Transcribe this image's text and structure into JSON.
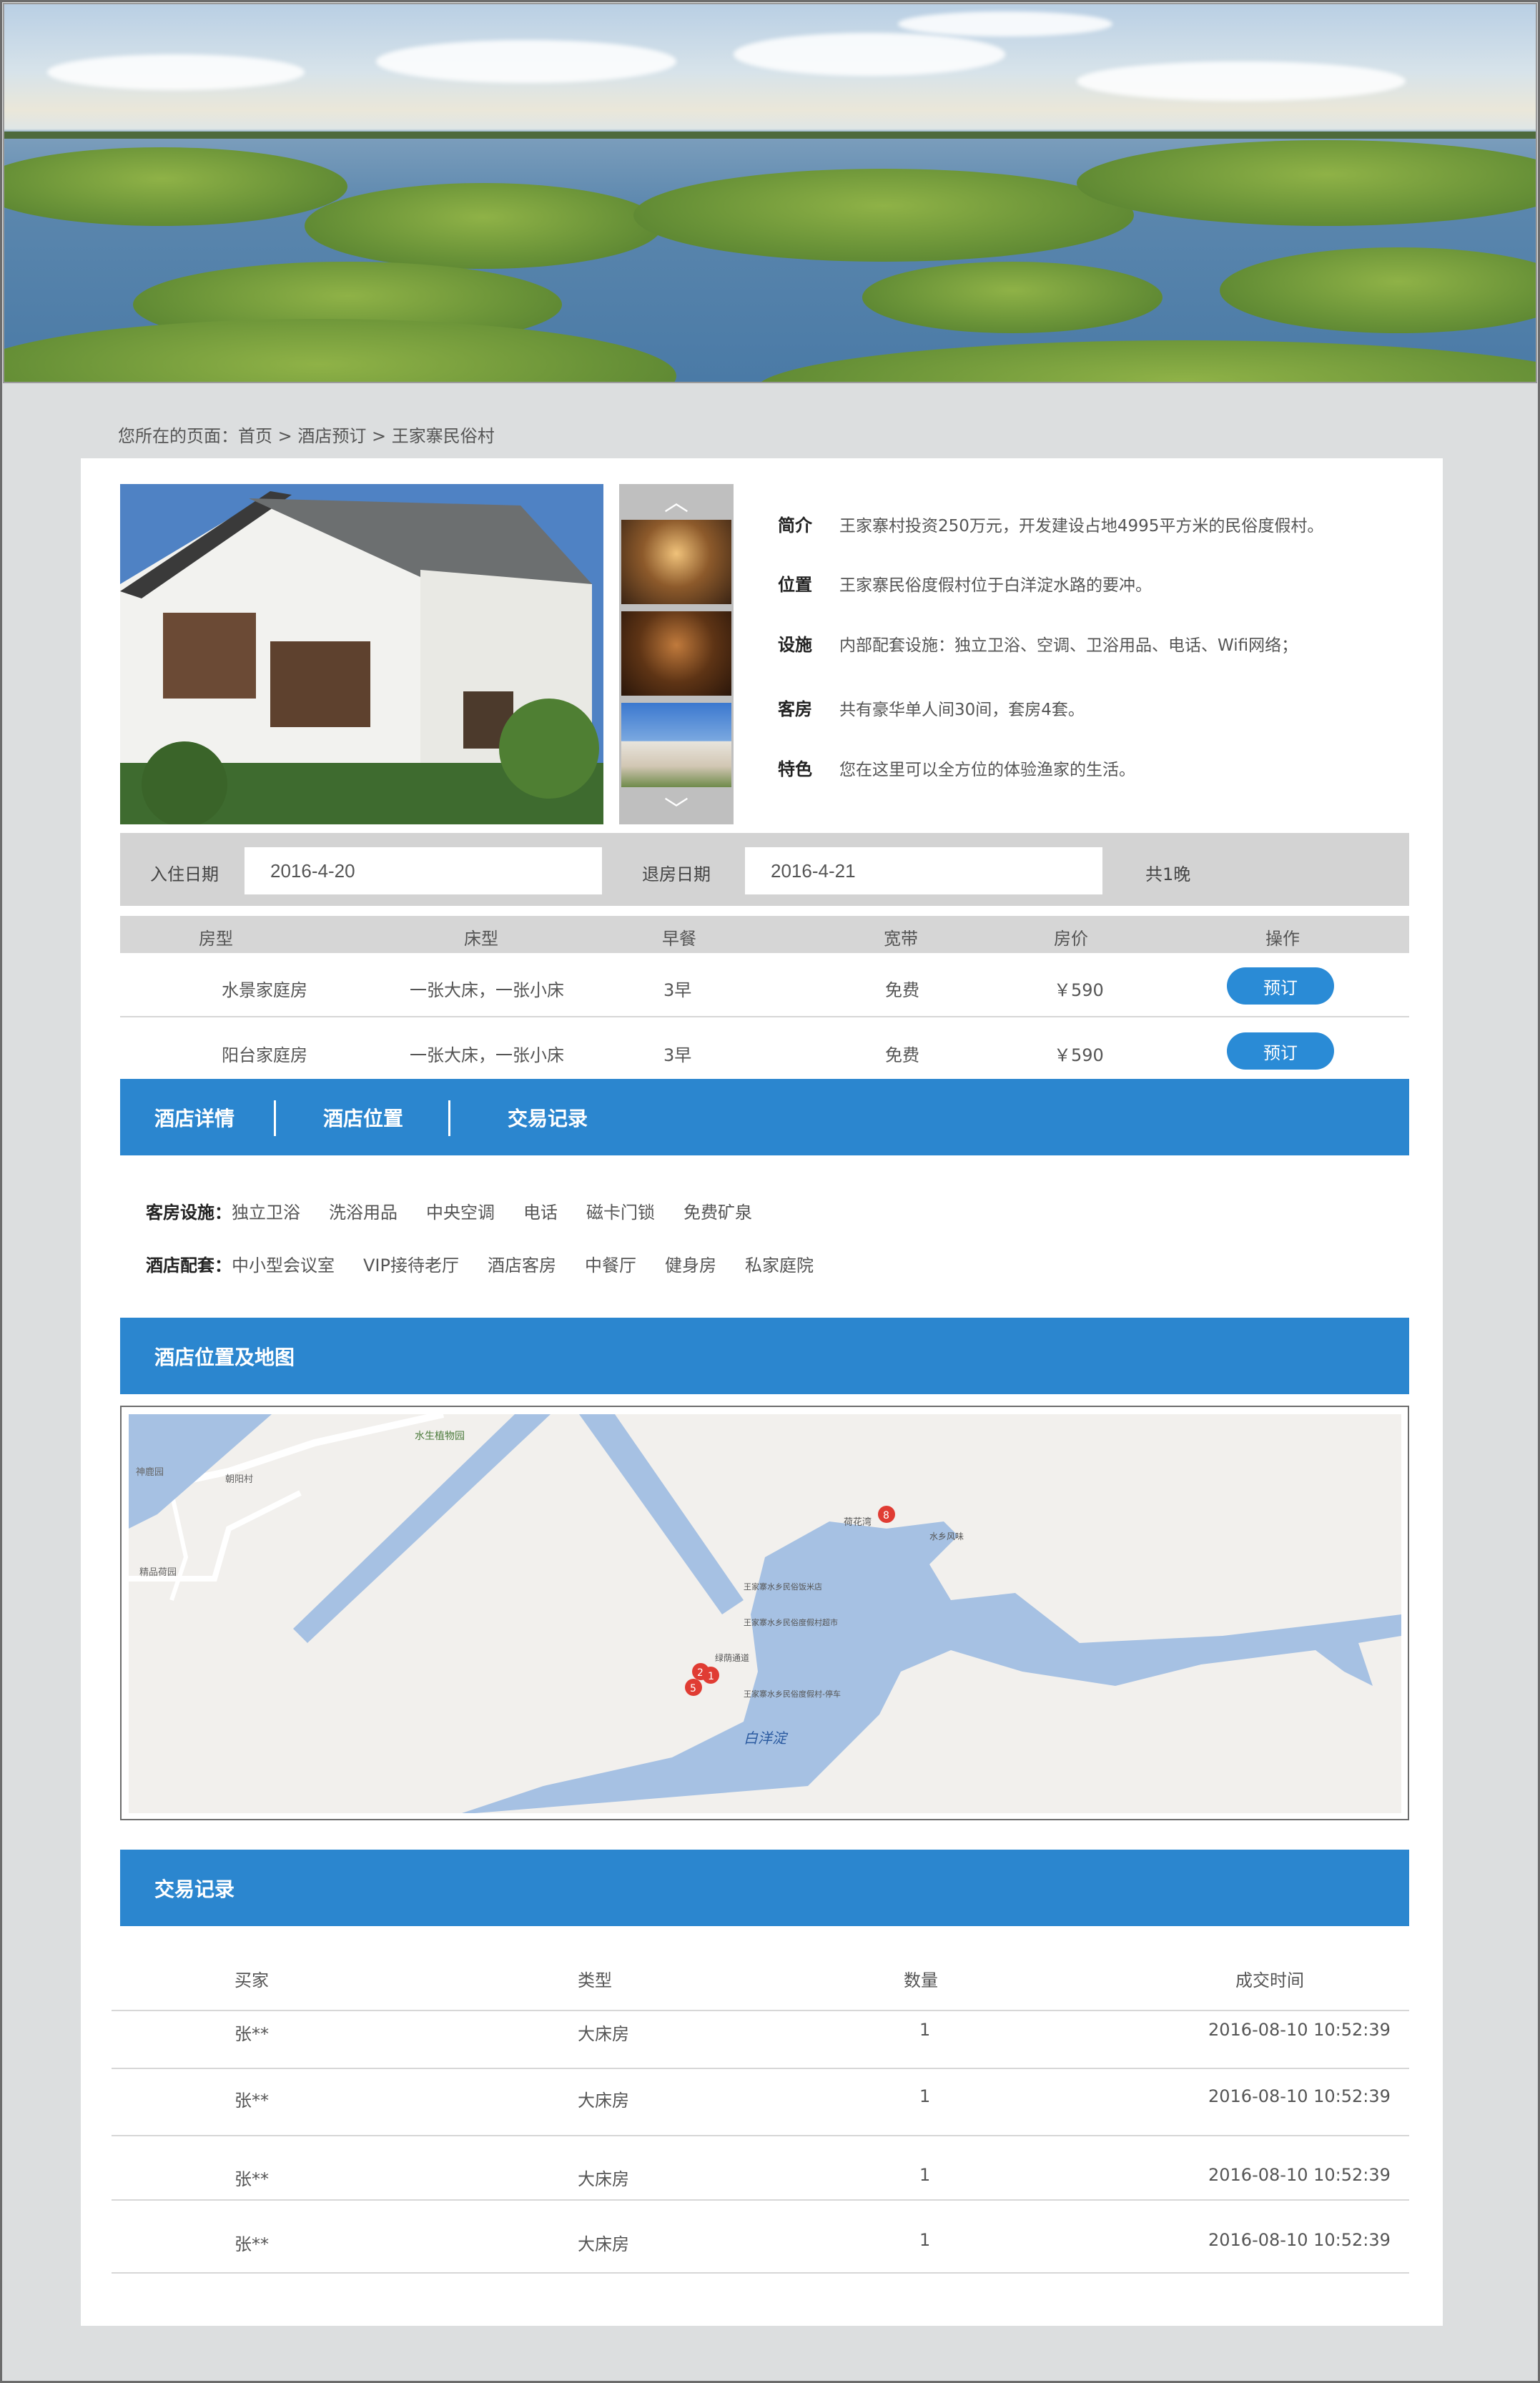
{
  "breadcrumb": {
    "prefix": "您所在的页面：",
    "home": "首页",
    "sep1": " > ",
    "booking": "酒店预订",
    "sep2": " > ",
    "current": "王家寨民俗村"
  },
  "info": [
    {
      "key": "简介",
      "value": "王家寨村投资250万元，开发建设占地4995平方米的民俗度假村。"
    },
    {
      "key": "位置",
      "value": "王家寨民俗度假村位于白洋淀水路的要冲。"
    },
    {
      "key": "设施",
      "value": "内部配套设施：独立卫浴、空调、卫浴用品、电话、Wifi网络；"
    },
    {
      "key": "客房",
      "value": "共有豪华单人间30间，套房4套。"
    },
    {
      "key": "特色",
      "value": "您在这里可以全方位的体验渔家的生活。"
    }
  ],
  "dates": {
    "checkin_label": "入住日期",
    "checkin_value": "2016-4-20",
    "checkout_label": "退房日期",
    "checkout_value": "2016-4-21",
    "nights": "共1晚"
  },
  "rooms": {
    "headers": [
      "房型",
      "床型",
      "早餐",
      "宽带",
      "房价",
      "操作"
    ],
    "rows": [
      {
        "type": "水景家庭房",
        "bed": "一张大床，一张小床",
        "breakfast": "3早",
        "broadband": "免费",
        "price": "￥590",
        "action": "预订"
      },
      {
        "type": "阳台家庭房",
        "bed": "一张大床，一张小床",
        "breakfast": "3早",
        "broadband": "免费",
        "price": "￥590",
        "action": "预订"
      }
    ]
  },
  "tabs": [
    "酒店详情",
    "酒店位置",
    "交易记录"
  ],
  "facilities": {
    "room_label": "客房设施：",
    "room_items": [
      "独立卫浴",
      "洗浴用品",
      "中央空调",
      "电话",
      "磁卡门锁",
      "免费矿泉"
    ],
    "hotel_label": "酒店配套：",
    "hotel_items": [
      "中小型会议室",
      "VIP接待老厅",
      "酒店客房",
      "中餐厅",
      "健身房",
      "私家庭院"
    ]
  },
  "map_section": {
    "title": "酒店位置及地图",
    "labels": {
      "lake": "白洋淀",
      "plant_garden": "水生植物园",
      "shenqu": "神鹿园",
      "chaoyang": "朝阳村",
      "jingpin": "精品荷园",
      "hehua": "荷花湾",
      "shuixiang": "水乡风味",
      "wj1": "王家寨水乡民俗饭米店",
      "wj2": "王家寨水乡民俗度假村超市",
      "lujing": "绿荫通道",
      "wj3": "王家寨水乡民俗度假村-停车",
      "pin8": "8",
      "pin2": "2",
      "pin1": "1",
      "pin5": "5"
    }
  },
  "trades_section": {
    "title": "交易记录",
    "headers": [
      "买家",
      "类型",
      "数量",
      "成交时间"
    ],
    "rows": [
      {
        "buyer": "张**",
        "type": "大床房",
        "qty": "1",
        "time": "2016-08-10 10:52:39"
      },
      {
        "buyer": "张**",
        "type": "大床房",
        "qty": "1",
        "time": "2016-08-10 10:52:39"
      },
      {
        "buyer": "张**",
        "type": "大床房",
        "qty": "1",
        "time": "2016-08-10 10:52:39"
      },
      {
        "buyer": "张**",
        "type": "大床房",
        "qty": "1",
        "time": "2016-08-10 10:52:39"
      }
    ]
  },
  "colors": {
    "accent": "#2b86cf",
    "button": "#2a8bd6",
    "page_bg": "#dcdedf",
    "table_head": "#d6d6d6"
  }
}
